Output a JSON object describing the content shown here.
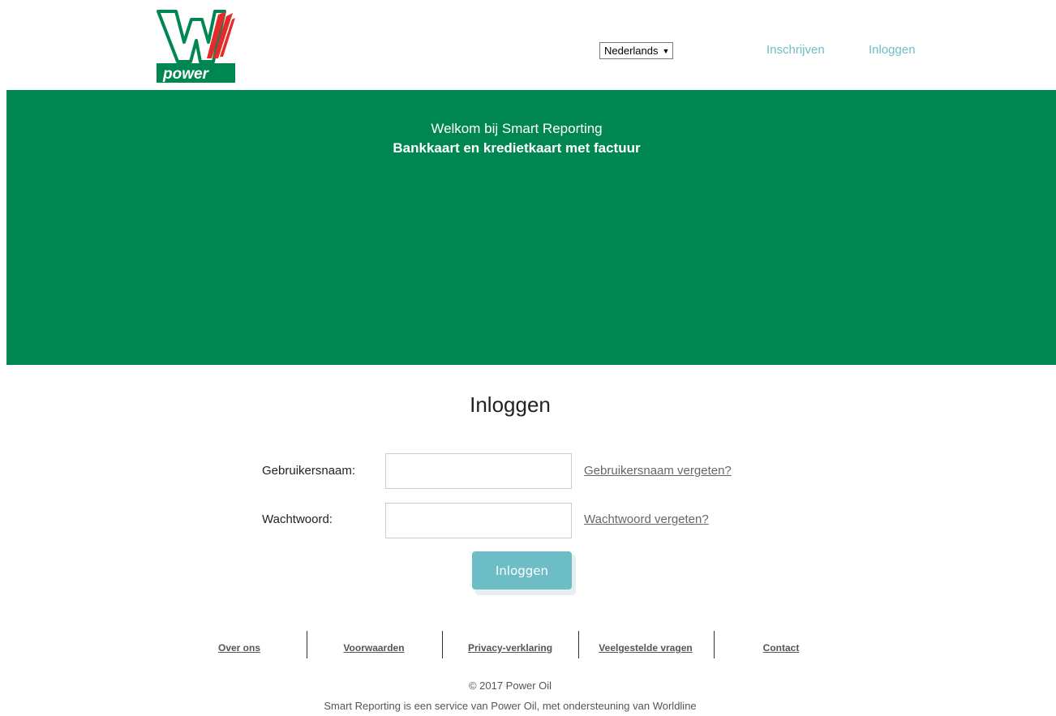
{
  "header": {
    "logo": {
      "text": "power",
      "colors": {
        "green": "#008751",
        "red": "#e32b2b"
      }
    },
    "language": {
      "selected": "Nederlands",
      "caret": "▼"
    },
    "nav": {
      "signup": "Inschrijven",
      "login": "Inloggen"
    }
  },
  "banner": {
    "line1": "Welkom bij Smart Reporting",
    "line2": "Bankkaart en kredietkaart met factuur",
    "background": "#008751"
  },
  "login": {
    "title": "Inloggen",
    "username_label": "Gebruikersnaam:",
    "username_value": "",
    "password_label": "Wachtwoord:",
    "password_value": "",
    "forgot_username": "Gebruikersnaam vergeten?",
    "forgot_password": "Wachtwoord vergeten?",
    "submit": "Inloggen",
    "accent": "#6dbdc6"
  },
  "footer": {
    "links": [
      "Over ons",
      "Voorwaarden",
      "Privacy-verklaring",
      "Veelgestelde vragen",
      "Contact"
    ],
    "copyright": "© 2017 Power Oil",
    "service": "Smart Reporting is een service van Power Oil, met ondersteuning van Worldline"
  }
}
